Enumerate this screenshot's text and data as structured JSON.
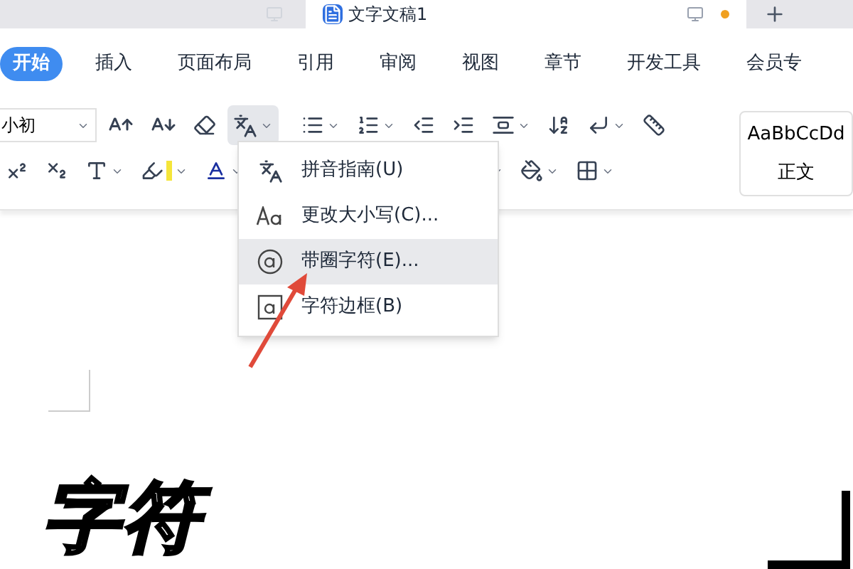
{
  "document_tabs": [
    {
      "title": "文字文稿1",
      "selected": true
    }
  ],
  "menu_tabs": [
    {
      "label": "开始",
      "selected": true
    },
    {
      "label": "插入",
      "selected": false
    },
    {
      "label": "页面布局",
      "selected": false
    },
    {
      "label": "引用",
      "selected": false
    },
    {
      "label": "审阅",
      "selected": false
    },
    {
      "label": "视图",
      "selected": false
    },
    {
      "label": "章节",
      "selected": false
    },
    {
      "label": "开发工具",
      "selected": false
    },
    {
      "label": "会员专",
      "selected": false
    }
  ],
  "toolbar": {
    "font_size": "小初",
    "style_preview": "AaBbCcDd",
    "style_name": "正文"
  },
  "dropdown_menu": {
    "items": [
      {
        "label": "拼音指南(U)",
        "selected": false
      },
      {
        "label": "更改大小写(C)...",
        "selected": false
      },
      {
        "label": "带圈字符(E)...",
        "selected": true
      },
      {
        "label": "字符边框(B)",
        "selected": false
      }
    ]
  },
  "caption": "字符"
}
